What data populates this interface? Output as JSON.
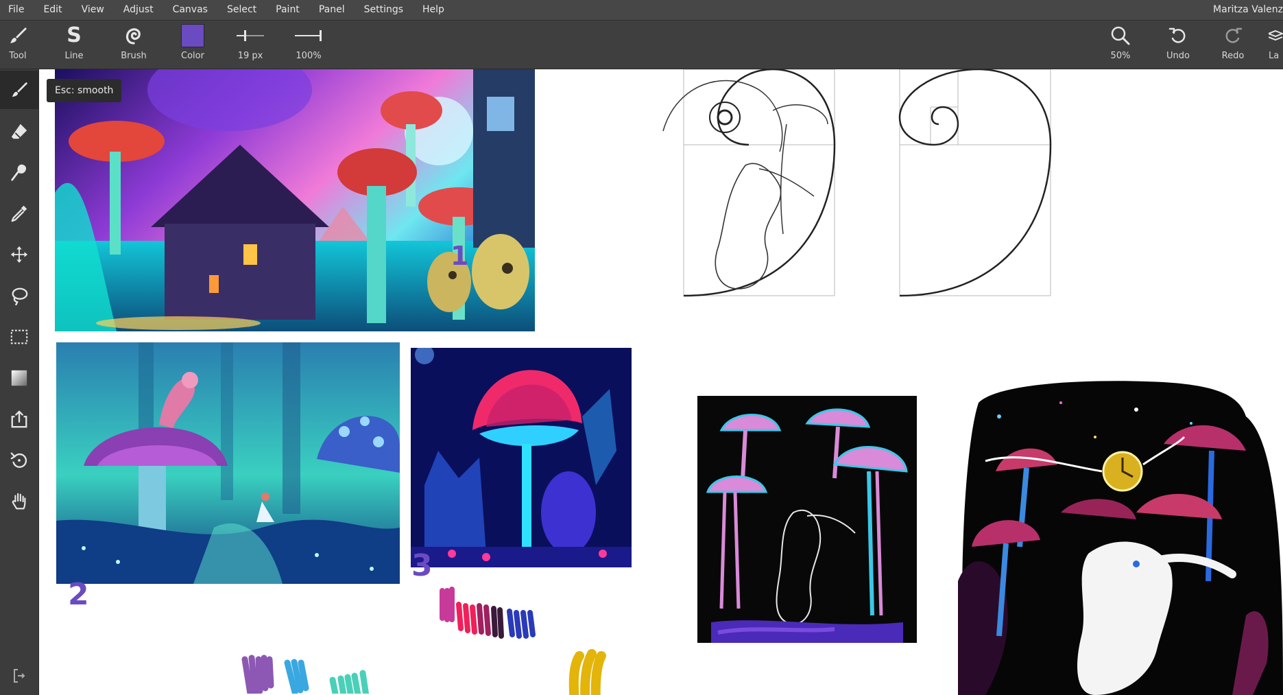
{
  "menu": {
    "items": [
      "File",
      "Edit",
      "View",
      "Adjust",
      "Canvas",
      "Select",
      "Paint",
      "Panel",
      "Settings",
      "Help"
    ],
    "user": "Maritza Valenz"
  },
  "toolbar": {
    "tool_label": "Tool",
    "line_label": "Line",
    "brush_label": "Brush",
    "color_label": "Color",
    "color_value": "#6a4bc2",
    "size_label": "19 px",
    "opacity_label": "100%",
    "zoom_label": "50%",
    "undo_label": "Undo",
    "redo_label": "Redo",
    "layers_label": "La"
  },
  "sidebar": {
    "tooltip": "Esc: smooth",
    "tools": [
      "brush-icon",
      "eraser-icon",
      "smudge-icon",
      "eyedropper-icon",
      "move-icon",
      "lasso-icon",
      "rect-select-icon",
      "gradient-icon",
      "export-icon",
      "rotate-icon",
      "hand-icon"
    ]
  },
  "canvas": {
    "marks": [
      "1",
      "2",
      "3"
    ]
  },
  "colors": {
    "menubar": "#474747",
    "toolbar": "#3f3f3f",
    "sidebar": "#3c3c3c",
    "accent": "#6a4bc2"
  }
}
